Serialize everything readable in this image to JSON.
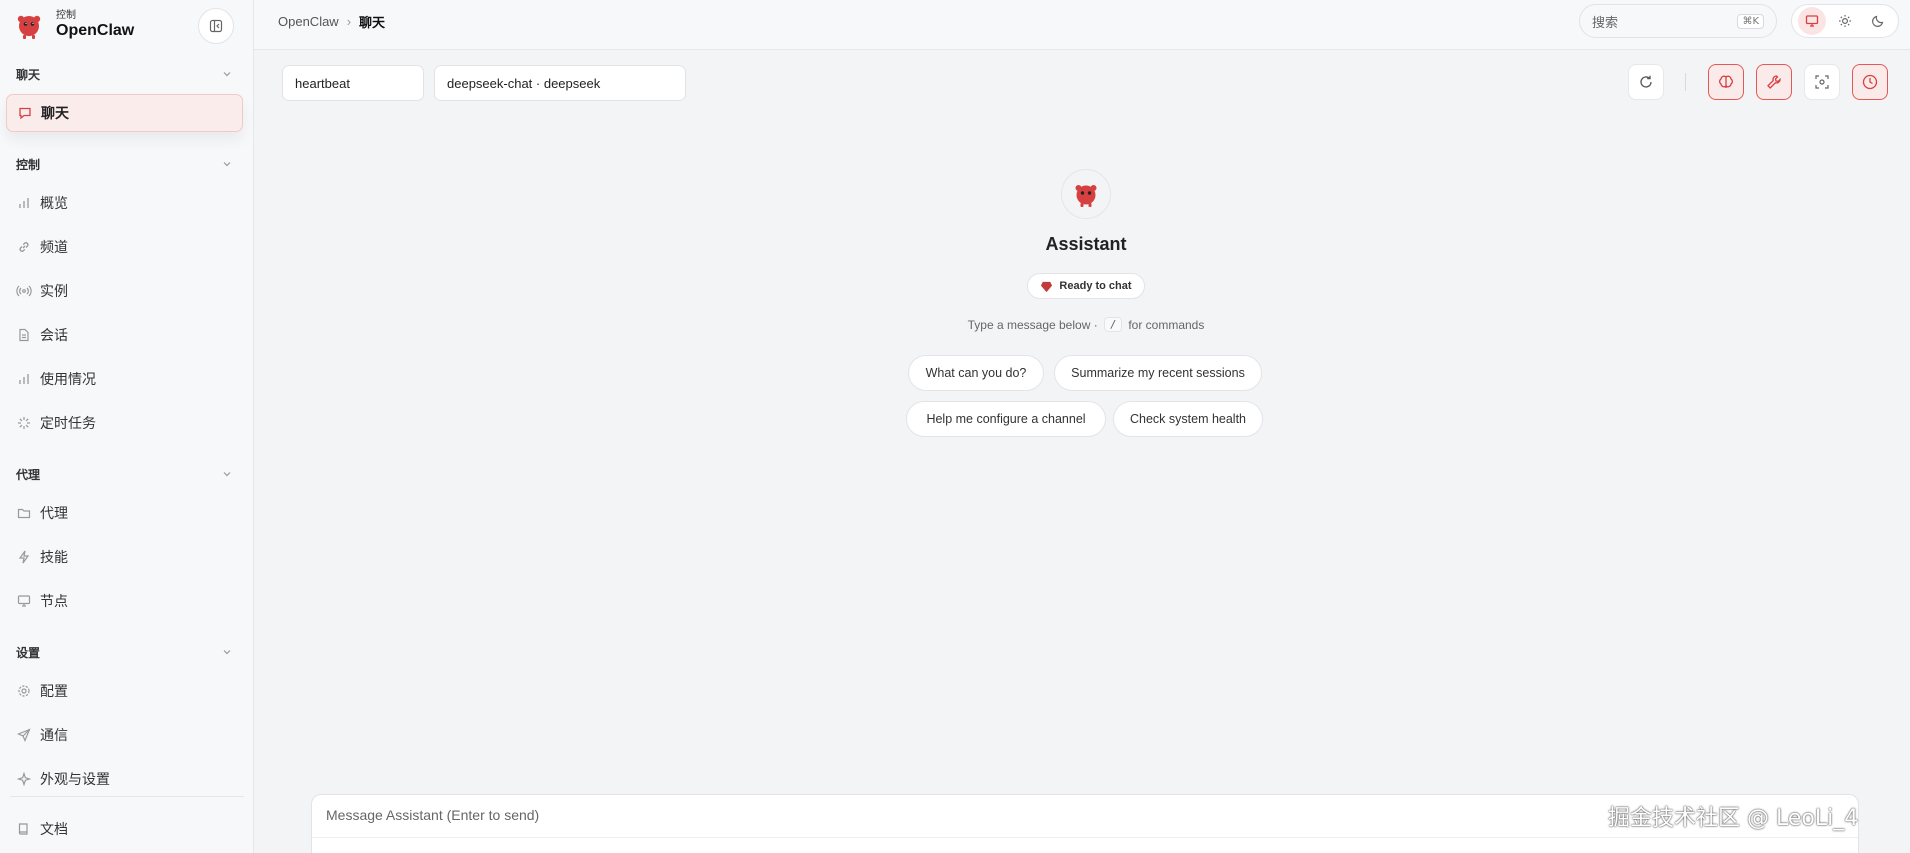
{
  "brand": {
    "subtitle": "控制",
    "title": "OpenClaw",
    "accent": "#d64040"
  },
  "sidebar": {
    "sections": [
      {
        "label": "聊天",
        "items": [
          {
            "label": "聊天",
            "icon": "chat-bubble-icon",
            "active": true
          }
        ]
      },
      {
        "label": "控制",
        "items": [
          {
            "label": "概览",
            "icon": "bar-chart-icon"
          },
          {
            "label": "频道",
            "icon": "link-icon"
          },
          {
            "label": "实例",
            "icon": "broadcast-icon"
          },
          {
            "label": "会话",
            "icon": "document-icon"
          },
          {
            "label": "使用情况",
            "icon": "bar-chart-icon"
          },
          {
            "label": "定时任务",
            "icon": "loader-icon"
          }
        ]
      },
      {
        "label": "代理",
        "items": [
          {
            "label": "代理",
            "icon": "folder-icon"
          },
          {
            "label": "技能",
            "icon": "lightning-icon"
          },
          {
            "label": "节点",
            "icon": "monitor-icon"
          }
        ]
      },
      {
        "label": "设置",
        "items": [
          {
            "label": "配置",
            "icon": "gear-icon"
          },
          {
            "label": "通信",
            "icon": "send-icon"
          },
          {
            "label": "外观与设置",
            "icon": "sparkle-icon"
          }
        ]
      }
    ],
    "footer": {
      "label": "文档",
      "icon": "book-icon"
    }
  },
  "topbar": {
    "breadcrumb": {
      "root": "OpenClaw",
      "separator": "›",
      "current": "聊天"
    },
    "search": {
      "label": "搜索",
      "shortcut": "⌘K"
    },
    "theme": {
      "active": "system"
    }
  },
  "chat": {
    "session_select": "heartbeat",
    "model_select": "deepseek-chat · deepseek",
    "assistant_name": "Assistant",
    "status": "Ready to chat",
    "hint_before": "Type a message below ·",
    "hint_key": "/",
    "hint_after": "for commands",
    "suggestions": [
      "What can you do?",
      "Summarize my recent sessions",
      "Help me configure a channel",
      "Check system health"
    ],
    "composer_placeholder": "Message Assistant (Enter to send)"
  },
  "watermark": "掘金技术社区 @ LeoLi_4"
}
